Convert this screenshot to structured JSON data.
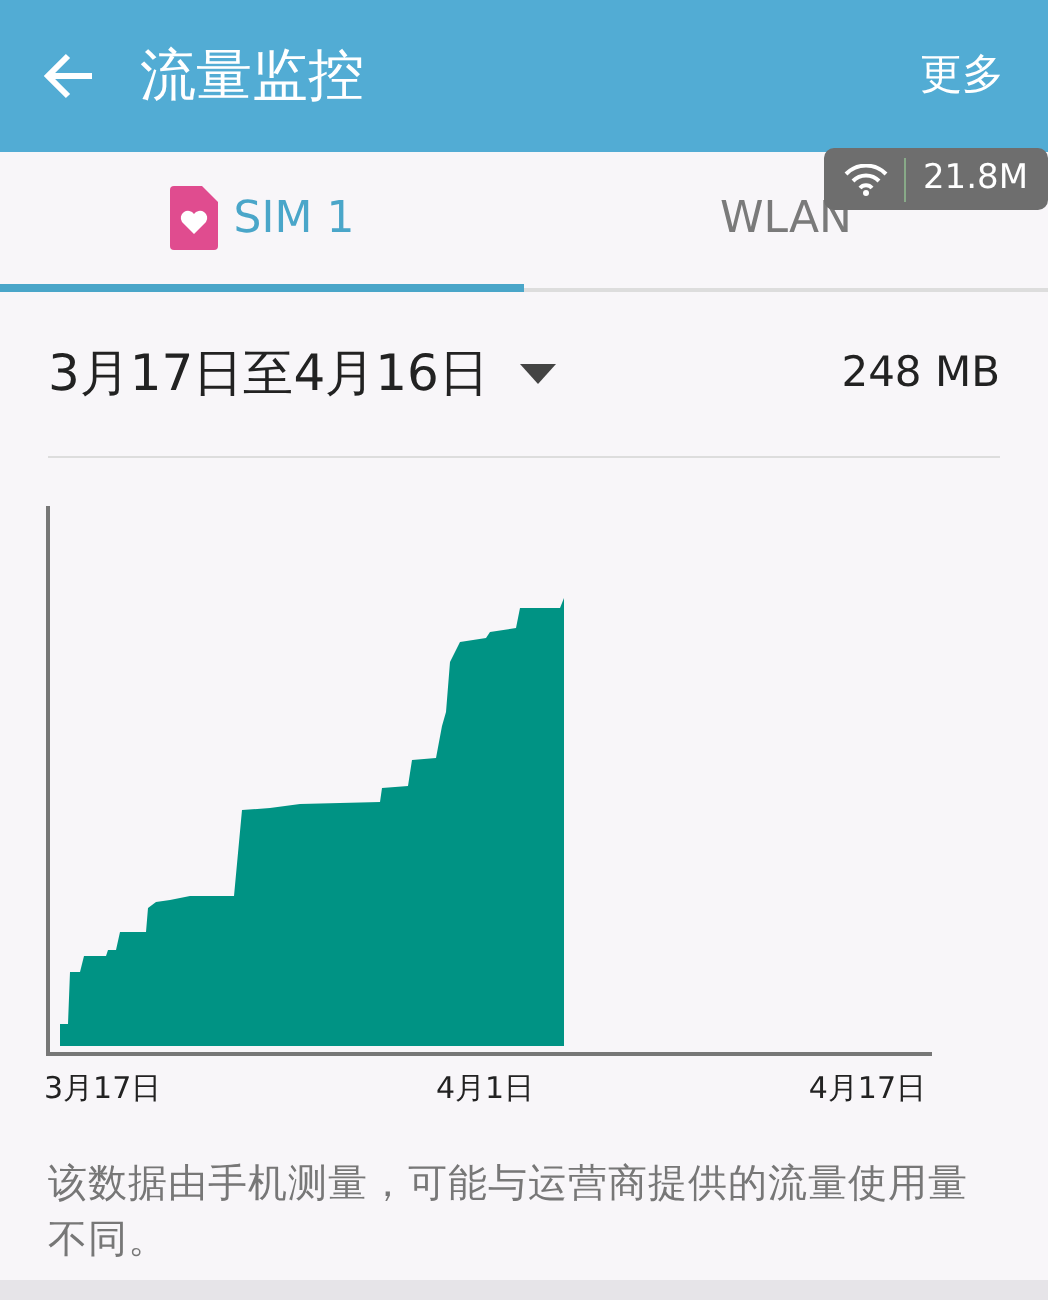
{
  "header": {
    "title": "流量监控",
    "action": "更多"
  },
  "speed_overlay": {
    "reading": "21.8M"
  },
  "tabs": [
    {
      "label": "SIM 1",
      "kind": "sim",
      "selected": true
    },
    {
      "label": "WLAN",
      "kind": "plain",
      "selected": false
    }
  ],
  "period": {
    "range": "3月17日至4月16日",
    "total": "248 MB"
  },
  "usage_graph": {
    "axis_labels": [
      "3月17日",
      "4月1日",
      "4月17日"
    ]
  },
  "footnote": "该数据由手机测量，可能与运营商提供的流量使用量不同。"
}
